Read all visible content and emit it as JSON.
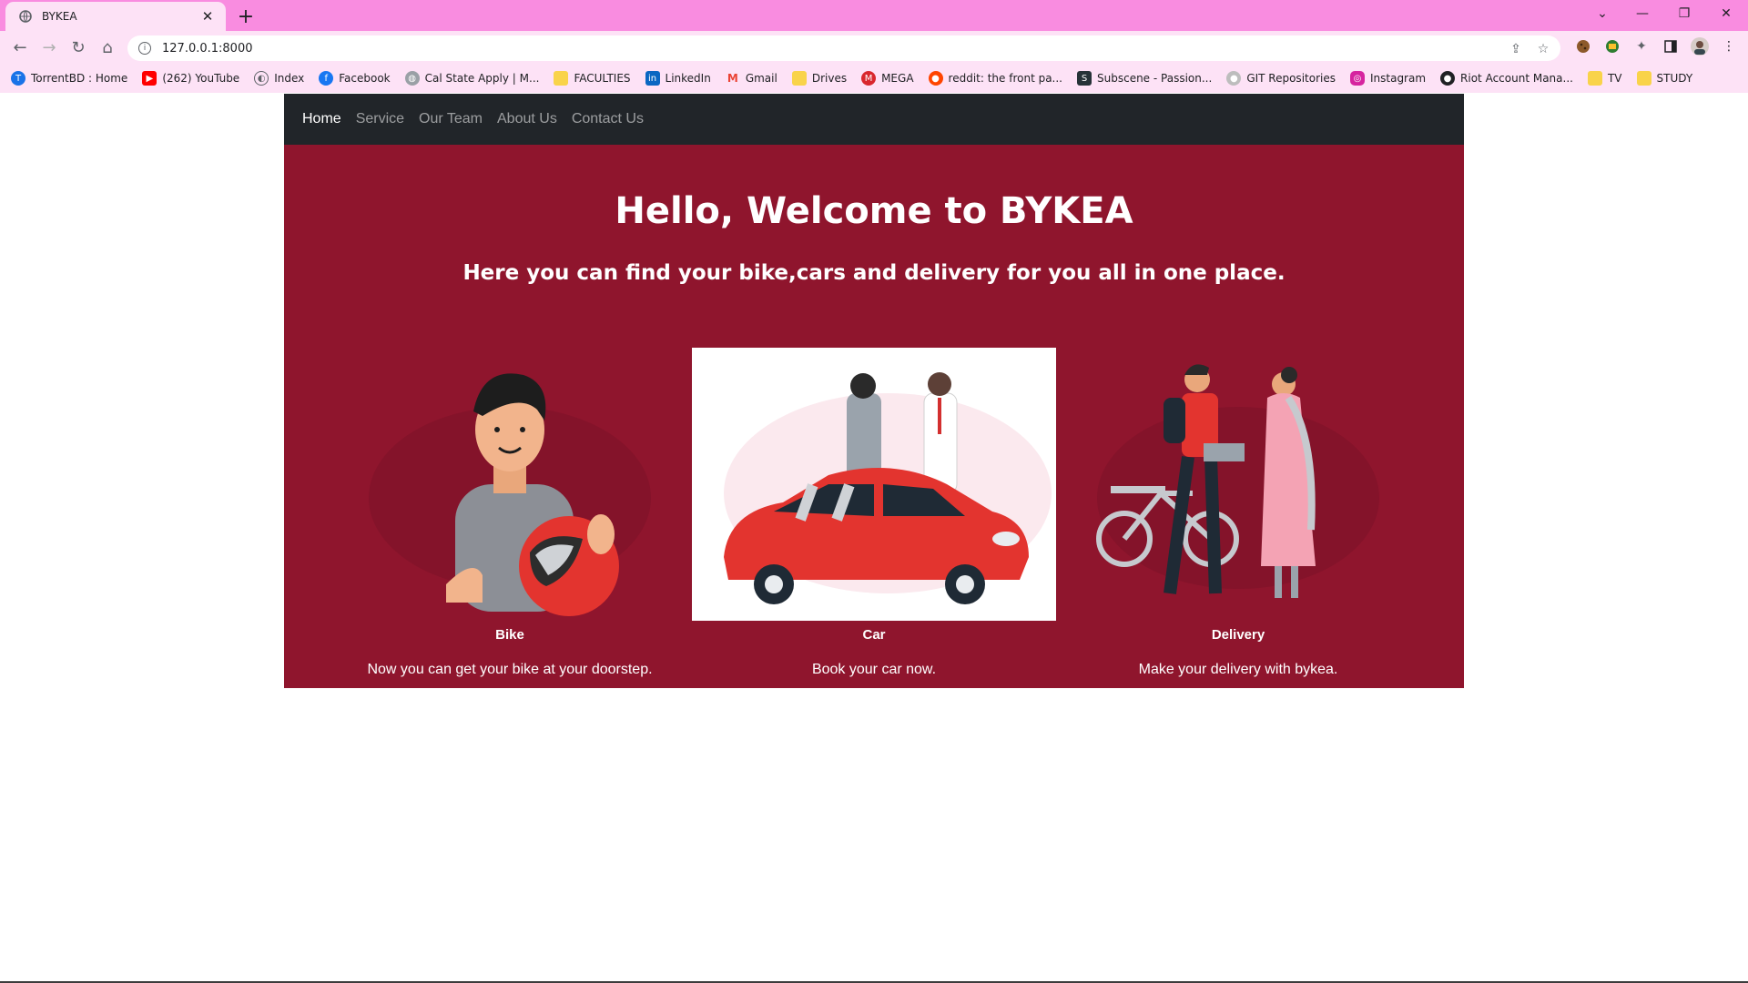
{
  "browser": {
    "tab_title": "BYKEA",
    "url": "127.0.0.1:8000",
    "bookmarks": [
      {
        "label": "TorrentBD : Home",
        "icon": "torrentbd-icon",
        "color": "#1a73e8"
      },
      {
        "label": "(262) YouTube",
        "icon": "youtube-icon",
        "color": "#ff0000"
      },
      {
        "label": "Index",
        "icon": "index-icon",
        "color": "#5f6368"
      },
      {
        "label": "Facebook",
        "icon": "facebook-icon",
        "color": "#1877f2"
      },
      {
        "label": "Cal State Apply | M...",
        "icon": "globe-icon",
        "color": "#9aa0a6"
      },
      {
        "label": "FACULTIES",
        "icon": "folder-icon",
        "color": "#f9d34a"
      },
      {
        "label": "LinkedIn",
        "icon": "linkedin-icon",
        "color": "#0a66c2"
      },
      {
        "label": "Gmail",
        "icon": "gmail-icon",
        "color": "#ea4335"
      },
      {
        "label": "Drives",
        "icon": "folder-icon",
        "color": "#f9d34a"
      },
      {
        "label": "MEGA",
        "icon": "mega-icon",
        "color": "#d9272e"
      },
      {
        "label": "reddit: the front pa...",
        "icon": "reddit-icon",
        "color": "#ff4500"
      },
      {
        "label": "Subscene - Passion...",
        "icon": "subscene-icon",
        "color": "#263238"
      },
      {
        "label": "GIT Repositories",
        "icon": "github-icon",
        "color": "#bdbdbd"
      },
      {
        "label": "Instagram",
        "icon": "instagram-icon",
        "color": "#d6249f"
      },
      {
        "label": "Riot Account Mana...",
        "icon": "riot-icon",
        "color": "#202124"
      },
      {
        "label": "TV",
        "icon": "folder-icon",
        "color": "#f9d34a"
      },
      {
        "label": "STUDY",
        "icon": "folder-icon",
        "color": "#f9d34a"
      }
    ]
  },
  "nav": {
    "items": [
      "Home",
      "Service",
      "Our Team",
      "About Us",
      "Contact Us"
    ],
    "active": "Home"
  },
  "hero": {
    "title": "Hello, Welcome to BYKEA",
    "subtitle": "Here you can find your bike,cars and delivery for you all in one place."
  },
  "cards": [
    {
      "name": "Bike",
      "desc": "Now you can get your bike at your doorstep."
    },
    {
      "name": "Car",
      "desc": "Book your car now."
    },
    {
      "name": "Delivery",
      "desc": "Make your delivery with bykea."
    }
  ],
  "colors": {
    "hero_bg": "#8f152d",
    "navbar_bg": "#212529",
    "tabstrip_bg": "#f98ce0",
    "toolbar_bg": "#fde2f6"
  }
}
